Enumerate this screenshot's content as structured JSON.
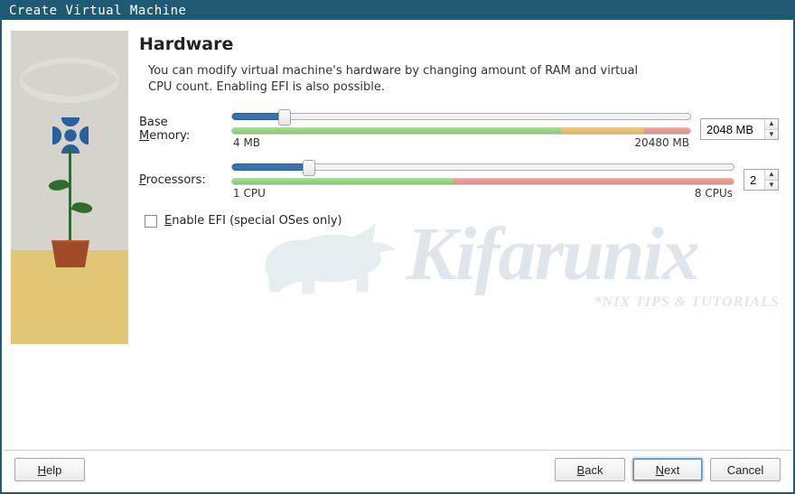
{
  "window": {
    "title": "Create Virtual Machine"
  },
  "page": {
    "heading": "Hardware",
    "description": "You can modify virtual machine's hardware by changing amount of RAM and virtual CPU count. Enabling EFI is also possible."
  },
  "memory": {
    "label_pre": "Base ",
    "label_u": "M",
    "label_post": "emory:",
    "min_label": "4 MB",
    "max_label": "20480 MB",
    "value": "2048 MB",
    "min": 4,
    "max": 20480,
    "current": 2048,
    "thumb_percent": 10,
    "gauge_green_percent": 72,
    "gauge_orange_percent": 18,
    "gauge_red_percent": 10
  },
  "cpu": {
    "label_u": "P",
    "label_post": "rocessors:",
    "min_label": "1 CPU",
    "max_label": "8 CPUs",
    "value": "2",
    "min": 1,
    "max": 8,
    "current": 2,
    "thumb_percent": 14,
    "gauge_green_percent": 44,
    "gauge_orange_percent": 0,
    "gauge_red_percent": 56
  },
  "efi": {
    "label_u": "E",
    "label_post": "nable EFI (special OSes only)",
    "checked": false
  },
  "footer": {
    "help_u": "H",
    "help_post": "elp",
    "back_u": "B",
    "back_post": "ack",
    "next_u": "N",
    "next_post": "ext",
    "cancel": "Cancel"
  },
  "watermark": {
    "text": "Kifarunix",
    "sub": "*NIX TIPS & TUTORIALS"
  }
}
